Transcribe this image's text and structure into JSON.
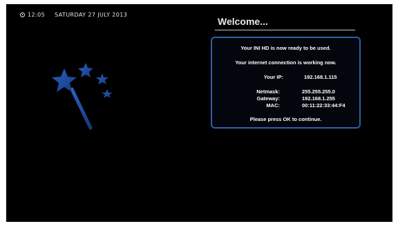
{
  "status_bar": {
    "time": "12:05",
    "date": "SATURDAY 27 JULY 2013"
  },
  "welcome": {
    "title": "Welcome...",
    "ready_message": "Your INI HD is now ready to be used.",
    "connection_message": "Your internet connection is working now.",
    "ip": {
      "label": "Your IP:",
      "value": "192.168.1.115"
    },
    "netmask": {
      "label": "Netmask:",
      "value": "255.255.255.0"
    },
    "gateway": {
      "label": "Gateway:",
      "value": "192.168.1.255"
    },
    "mac": {
      "label": "MAC:",
      "value": "00:11:22:33:44:F4"
    },
    "footer": "Please press OK to continue."
  },
  "colors": {
    "accent": "#2f5fa8",
    "wand": "#1f4e9c",
    "background": "#000000",
    "text": "#ffffff"
  },
  "icons": {
    "clock": "clock-icon",
    "wizard": "magic-wand-icon"
  }
}
